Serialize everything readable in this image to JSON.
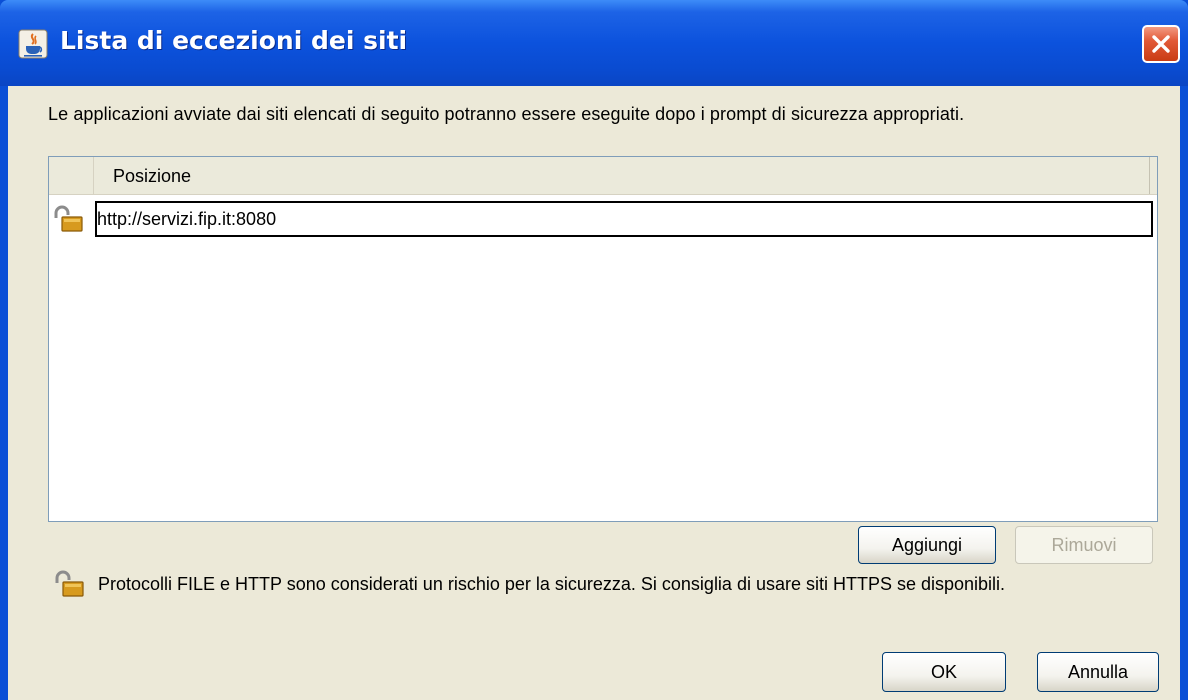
{
  "window": {
    "title": "Lista di eccezioni dei siti",
    "title_icon": "java-icon",
    "close_icon": "close-icon"
  },
  "intro_text": "Le applicazioni avviate dai siti elencati di seguito potranno essere eseguite dopo i prompt di sicurezza appropriati.",
  "table": {
    "columns": [
      "",
      "Posizione"
    ],
    "rows": [
      {
        "icon": "open-lock-icon",
        "location": "http://servizi.fip.it:8080"
      }
    ]
  },
  "buttons": {
    "add": "Aggiungi",
    "remove": "Rimuovi",
    "ok": "OK",
    "cancel": "Annulla"
  },
  "warning": {
    "icon": "open-lock-icon",
    "text": "Protocolli FILE e HTTP sono considerati un rischio per la sicurezza.  Si consiglia di usare siti HTTPS se disponibili."
  },
  "colors": {
    "titlebar": "#0a52dd",
    "client_bg": "#ece9d8",
    "close_button": "#d9512b"
  }
}
